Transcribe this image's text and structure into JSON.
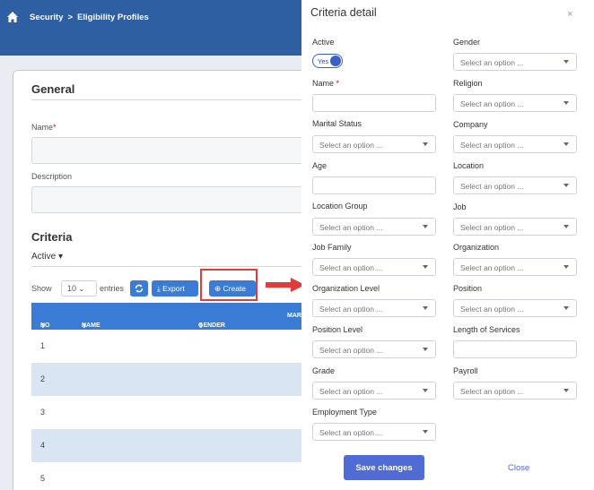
{
  "breadcrumb": {
    "section": "Security",
    "separator": ">",
    "page": "Eligibility Profiles"
  },
  "general": {
    "title": "General",
    "name_label": "Name",
    "name_required": "*",
    "description_label": "Description"
  },
  "criteria": {
    "title": "Criteria",
    "filter": "Active",
    "filter_caret": "▾",
    "show_label": "Show",
    "entries_value": "10",
    "entries_label": "entries",
    "export_label": "Export",
    "create_label": "Create",
    "columns": [
      "NO",
      "NAME",
      "GENDER",
      "MAR"
    ],
    "rows": [
      "1",
      "2",
      "3",
      "4",
      "5"
    ]
  },
  "modal": {
    "title": "Criteria detail",
    "close_x": "×",
    "active_label": "Active",
    "active_value": "Yes",
    "name_label": "Name",
    "name_required": "*",
    "marital_status_label": "Marital Status",
    "age_label": "Age",
    "location_group_label": "Location Group",
    "job_family_label": "Job Family",
    "organization_level_label": "Organization Level",
    "position_level_label": "Position Level",
    "grade_label": "Grade",
    "employment_type_label": "Employment Type",
    "gender_label": "Gender",
    "religion_label": "Religion",
    "company_label": "Company",
    "location_label": "Location",
    "job_label": "Job",
    "organization_label": "Organization",
    "position_label": "Position",
    "length_of_services_label": "Length of Services",
    "payroll_label": "Payroll",
    "select_placeholder": "Select an option ...",
    "save_label": "Save changes",
    "close_label": "Close"
  },
  "colors": {
    "topbar": "#2f5fa3",
    "table_header": "#3a7bd5",
    "row_alt": "#d9e5f3",
    "save_button": "#4e6bd6",
    "highlight": "#e03c3c"
  },
  "icons": [
    "home-icon",
    "refresh-icon",
    "download-icon",
    "plus-circle-icon",
    "chevron-down-icon",
    "sort-icon",
    "arrow-right-icon"
  ]
}
